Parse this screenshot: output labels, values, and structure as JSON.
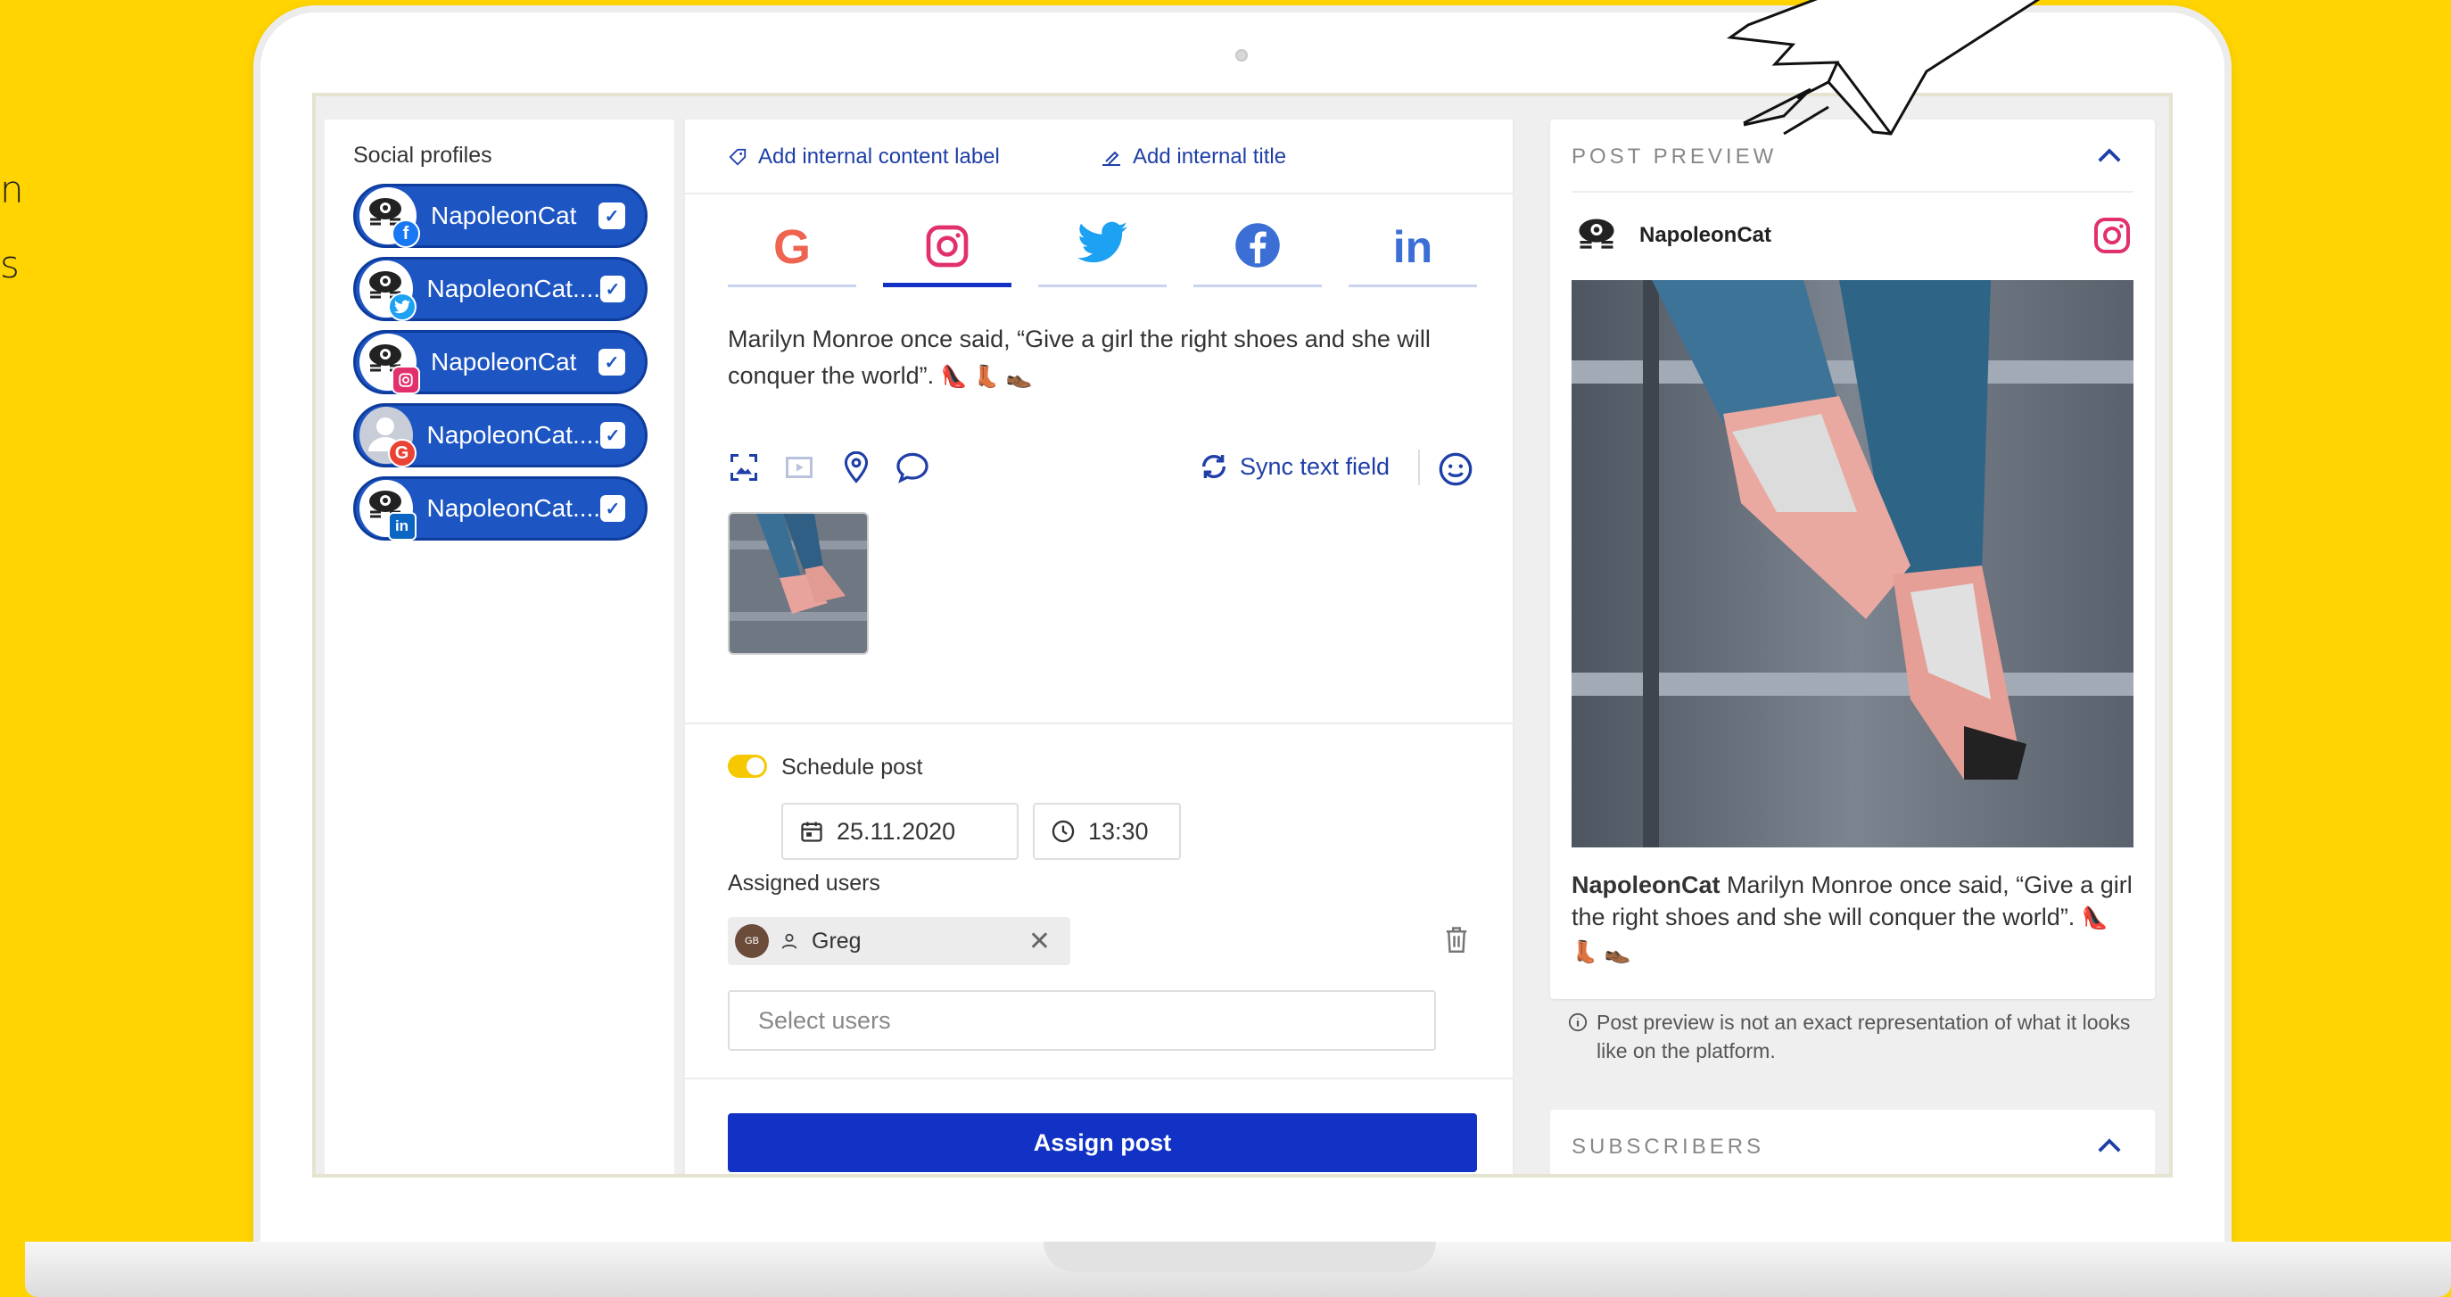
{
  "side_text": [
    "n",
    "s"
  ],
  "profiles": {
    "title": "Social profiles",
    "items": [
      {
        "name": "NapoleonCat",
        "network": "facebook",
        "badge_color": "#1877f2"
      },
      {
        "name": "NapoleonCat....",
        "network": "twitter",
        "badge_color": "#1da1f2"
      },
      {
        "name": "NapoleonCat",
        "network": "instagram",
        "badge_color": "#e1306c"
      },
      {
        "name": "NapoleonCat....",
        "network": "google",
        "badge_color": "#ea4335"
      },
      {
        "name": "NapoleonCat....",
        "network": "linkedin",
        "badge_color": "#0a66c2"
      }
    ]
  },
  "editor": {
    "add_label": "Add internal content label",
    "add_title": "Add internal title",
    "tabs": [
      "google",
      "instagram",
      "twitter",
      "facebook",
      "linkedin"
    ],
    "active_tab": "instagram",
    "post_text": "Marilyn Monroe once said, “Give a girl the right shoes and she will conquer the world”.",
    "post_emoji": "👠 👢 👞",
    "sync_label": "Sync text field",
    "schedule_label": "Schedule post",
    "schedule_enabled": true,
    "date": "25.11.2020",
    "time": "13:30",
    "assigned_label": "Assigned users",
    "user_initials": "GB",
    "user_name": "Greg",
    "select_placeholder": "Select users",
    "assign_button": "Assign post"
  },
  "preview": {
    "title": "POST PREVIEW",
    "account": "NapoleonCat",
    "caption_account": "NapoleonCat",
    "caption_text": "Marilyn Monroe once said, “Give a girl the right shoes and she will conquer the world”.",
    "caption_emoji": "👠 👢 👞",
    "note": "Post preview is not an exact representation of what it looks like on the platform."
  },
  "subscribers": {
    "title": "SUBSCRIBERS"
  },
  "colors": {
    "accent": "#1132c4",
    "profile_bg": "#1d55c3",
    "brand_yellow": "#ffd400"
  }
}
